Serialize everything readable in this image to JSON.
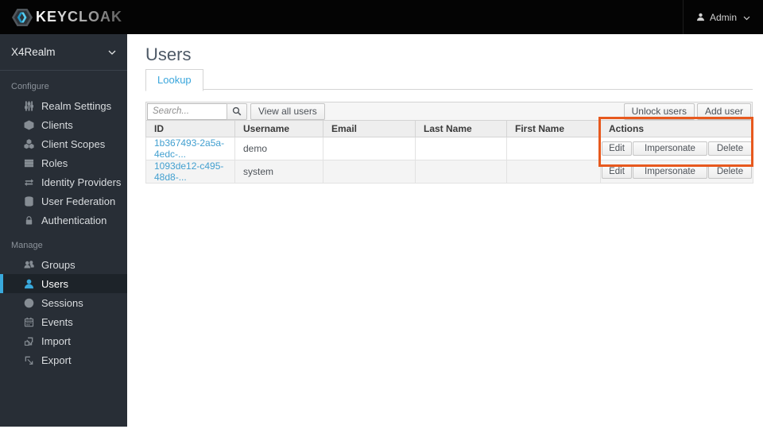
{
  "topbar": {
    "brand": "KEYCLOAK",
    "user_menu": {
      "label": "Admin"
    }
  },
  "sidebar": {
    "realm_selector": {
      "label": "X4Realm"
    },
    "sections": [
      {
        "label": "Configure",
        "items": [
          {
            "label": "Realm Settings",
            "icon": "sliders-icon",
            "active": false
          },
          {
            "label": "Clients",
            "icon": "cube-icon",
            "active": false
          },
          {
            "label": "Client Scopes",
            "icon": "cubes-icon",
            "active": false
          },
          {
            "label": "Roles",
            "icon": "roles-icon",
            "active": false
          },
          {
            "label": "Identity Providers",
            "icon": "exchange-arrows-icon",
            "active": false
          },
          {
            "label": "User Federation",
            "icon": "database-icon",
            "active": false
          },
          {
            "label": "Authentication",
            "icon": "lock-icon",
            "active": false
          }
        ]
      },
      {
        "label": "Manage",
        "items": [
          {
            "label": "Groups",
            "icon": "users-group-icon",
            "active": false
          },
          {
            "label": "Users",
            "icon": "user-icon",
            "active": true
          },
          {
            "label": "Sessions",
            "icon": "clock-icon",
            "active": false
          },
          {
            "label": "Events",
            "icon": "calendar-icon",
            "active": false
          },
          {
            "label": "Import",
            "icon": "import-icon",
            "active": false
          },
          {
            "label": "Export",
            "icon": "export-icon",
            "active": false
          }
        ]
      }
    ]
  },
  "main": {
    "title": "Users",
    "tabs": [
      {
        "label": "Lookup",
        "active": true
      }
    ],
    "toolbar": {
      "search_placeholder": "Search...",
      "search_value": "",
      "view_all_users_label": "View all users",
      "unlock_users_label": "Unlock users",
      "add_user_label": "Add user"
    },
    "table": {
      "columns": [
        "ID",
        "Username",
        "Email",
        "Last Name",
        "First Name",
        "Actions"
      ],
      "rows": [
        {
          "id": "1b367493-2a5a-4edc-...",
          "username": "demo",
          "email": "",
          "last_name": "",
          "first_name": "",
          "actions": [
            "Edit",
            "Impersonate",
            "Delete"
          ]
        },
        {
          "id": "1093de12-c495-48d8-...",
          "username": "system",
          "email": "",
          "last_name": "",
          "first_name": "",
          "actions": [
            "Edit",
            "Impersonate",
            "Delete"
          ]
        }
      ]
    },
    "annotation": {
      "purpose": "highlight-actions-column",
      "color": "#e7591e"
    }
  },
  "colors": {
    "accent_blue": "#39a9dc",
    "link_blue": "#43a0d0",
    "annotation_orange": "#e7591e",
    "topbar_bg": "#040404",
    "sidebar_bg": "#282e36"
  }
}
